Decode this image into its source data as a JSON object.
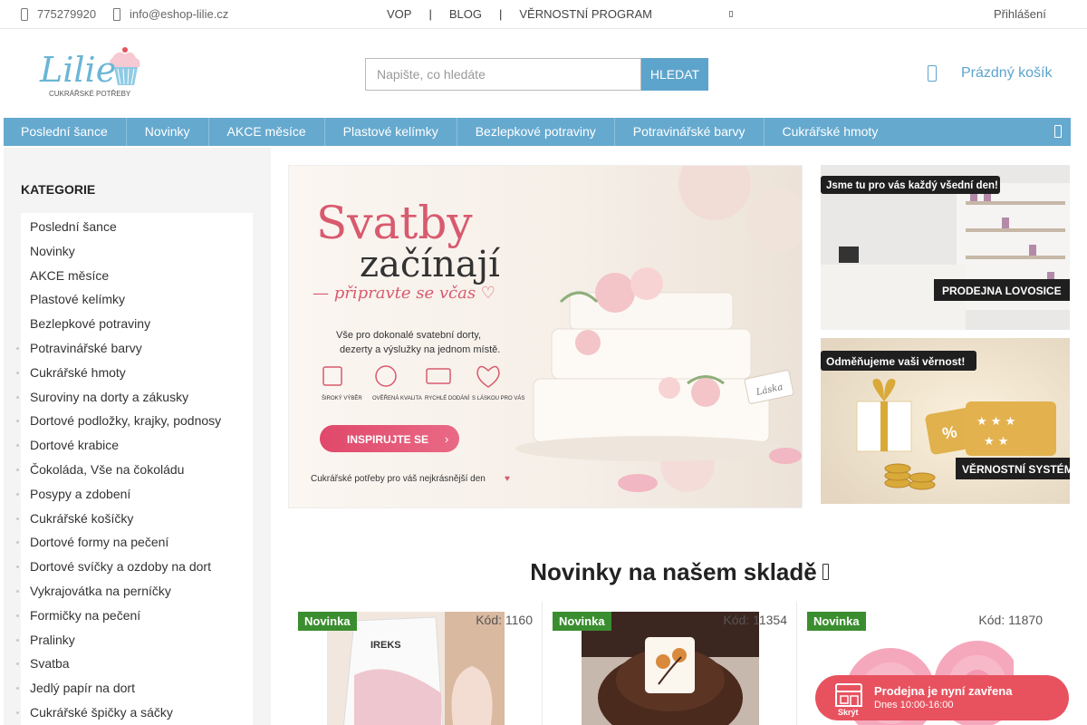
{
  "topbar": {
    "phone": "775279920",
    "email": "info@eshop-lilie.cz",
    "links": [
      "VOP",
      "BLOG",
      "VĚRNOSTNÍ PROGRAM"
    ],
    "login": "Přihlášení"
  },
  "header": {
    "logo_text": "Lilie",
    "logo_tagline": "CUKRÁŘSKÉ POTŘEBY",
    "search_placeholder": "Napište, co hledáte",
    "search_button": "HLEDAT",
    "cart_label": "Prázdný košík"
  },
  "nav": {
    "items": [
      "Poslední šance",
      "Novinky",
      "AKCE měsíce",
      "Plastové kelímky",
      "Bezlepkové potraviny",
      "Potravinářské barvy",
      "Cukrářské hmoty"
    ]
  },
  "sidebar": {
    "title": "KATEGORIE",
    "items": [
      "Poslední šance",
      "Novinky",
      "AKCE měsíce",
      "Plastové kelímky",
      "Bezlepkové potraviny",
      "Potravinářské barvy",
      "Cukrářské hmoty",
      "Suroviny na dorty a zákusky",
      "Dortové podložky, krajky, podnosy",
      "Dortové krabice",
      "Čokoláda, Vše na čokoládu",
      "Posypy a zdobení",
      "Cukrářské košíčky",
      "Dortové formy na pečení",
      "Dortové svíčky a ozdoby na dort",
      "Vykrajovátka na perníčky",
      "Formičky na pečení",
      "Pralinky",
      "Svatba",
      "Jedlý papír na dort",
      "Cukrářské špičky a sáčky"
    ]
  },
  "hero": {
    "title1": "Svatby",
    "title2": "začínají",
    "subtitle": "— připravte se včas ♡",
    "desc1": "Vše pro dokonalé svatební dorty,",
    "desc2": "dezerty a výslužky na jednom místě.",
    "features": [
      "ŠIROKÝ VÝBĚR",
      "OVĚŘENÁ KVALITA",
      "RYCHLÉ DODÁNÍ",
      "S LÁSKOU PRO VÁS"
    ],
    "cta": "INSPIRUJTE SE",
    "footer": "Cukrářské potřeby pro váš nejkrásnější den",
    "tag": "Láska"
  },
  "banners": {
    "b1_top": "Jsme tu pro vás každý všední den!",
    "b1_bottom": "PRODEJNA LOVOSICE",
    "b2_top": "Odměňujeme vaši věrnost!",
    "b2_bottom": "VĚRNOSTNÍ SYSTÉM"
  },
  "section": {
    "title": "Novinky na našem skladě"
  },
  "products": [
    {
      "badge": "Novinka",
      "code": "Kód: 1160",
      "brand": "IREKS"
    },
    {
      "badge": "Novinka",
      "code": "Kód: 11354"
    },
    {
      "badge": "Novinka",
      "code": "Kód: 11870"
    }
  ],
  "store": {
    "title": "Prodejna je nyní zavřena",
    "hours": "Dnes 10:00-16:00",
    "hide": "Skrýt"
  },
  "colors": {
    "accent": "#65a9cf",
    "badge": "#3b8e2f",
    "store": "#e8525f",
    "cta": "#e0486a"
  }
}
